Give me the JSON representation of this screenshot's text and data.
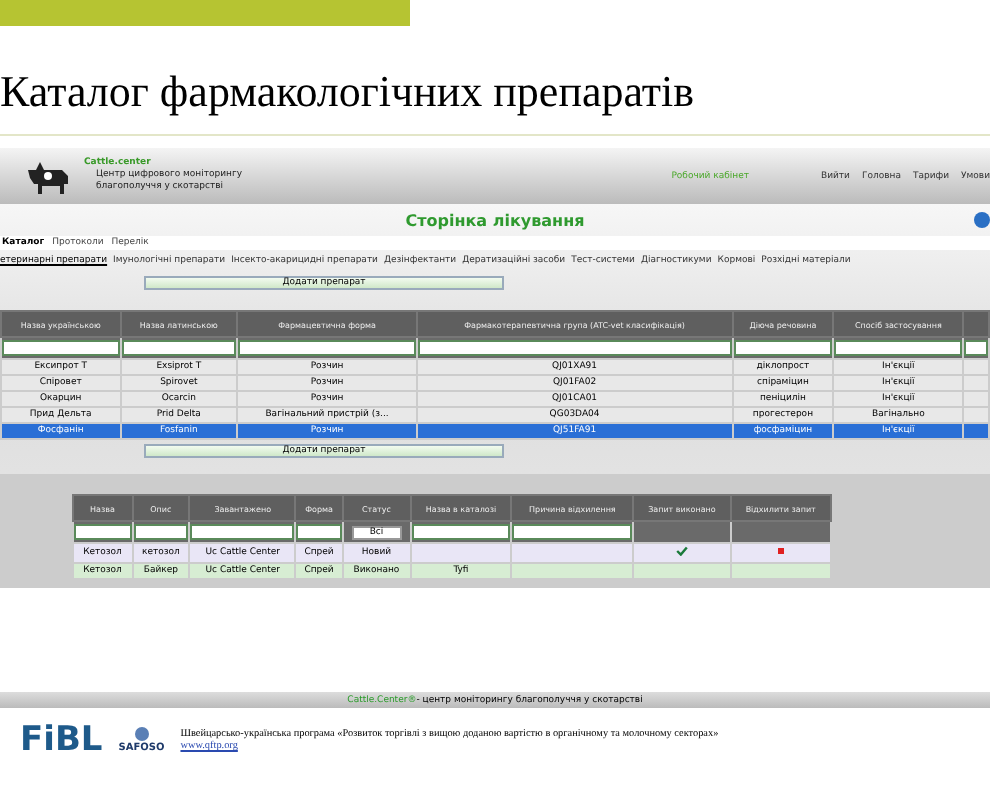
{
  "slide": {
    "title": "Каталог фармакологічних препаратів"
  },
  "header": {
    "brand": "Cattle.center",
    "tagline_1": "Центр цифрового моніторингу",
    "tagline_2": "благополуччя у скотарстві",
    "cabinet": "Робочий кабінет",
    "nav": [
      "Вийти",
      "Головна",
      "Тарифи",
      "Умови"
    ]
  },
  "page_title": "Сторінка лікування",
  "tabs": [
    {
      "label": "Каталог",
      "selected": true
    },
    {
      "label": "Протоколи",
      "selected": false
    },
    {
      "label": "Перелік",
      "selected": false
    }
  ],
  "subtabs": [
    {
      "label": "етеринарні препарати",
      "selected": true
    },
    {
      "label": "Імунологічні препарати",
      "selected": false
    },
    {
      "label": "Інсекто-акарицидні препарати",
      "selected": false
    },
    {
      "label": "Дезінфектанти",
      "selected": false
    },
    {
      "label": "Дератизаційні засоби",
      "selected": false
    },
    {
      "label": "Тест-системи",
      "selected": false
    },
    {
      "label": "Діагностикуми",
      "selected": false
    },
    {
      "label": "Кормові",
      "selected": false
    },
    {
      "label": "Розхідні матеріали",
      "selected": false
    }
  ],
  "add_button": "Додати препарат",
  "catalog": {
    "columns": [
      "Назва українською",
      "Назва латинською",
      "Фармацевтична форма",
      "Фармакотерапевтична група (ATC-vet класифікація)",
      "Діюча речовина",
      "Спосіб застосування"
    ],
    "rows": [
      {
        "cells": [
          "Ексипрот Т",
          "Exsiprot T",
          "Розчин",
          "QJ01XA91",
          "діклопрост",
          "Ін'єкції"
        ],
        "selected": false
      },
      {
        "cells": [
          "Спіровет",
          "Spirovet",
          "Розчин",
          "QJ01FA02",
          "спіраміцин",
          "Ін'єкції"
        ],
        "selected": false
      },
      {
        "cells": [
          "Окарцин",
          "Ocarcin",
          "Розчин",
          "QJ01CA01",
          "пеніцилін",
          "Ін'єкції"
        ],
        "selected": false
      },
      {
        "cells": [
          "Прид Дельта",
          "Prid Delta",
          "Вагінальний пристрій (з...",
          "QG03DA04",
          "прогестерон",
          "Вагінально"
        ],
        "selected": false
      },
      {
        "cells": [
          "Фосфанін",
          "Fosfanin",
          "Розчин",
          "QJ51FA91",
          "фосфаміцин",
          "Ін'єкції"
        ],
        "selected": true
      }
    ]
  },
  "add_button_2": "Додати препарат",
  "requests": {
    "columns": [
      "Назва",
      "Опис",
      "Завантажено",
      "Форма",
      "Статус",
      "Назва в каталозі",
      "Причина відхилення",
      "Запит виконано",
      "Відхилити запит"
    ],
    "status_filter": "Всі",
    "rows": [
      {
        "cells": [
          "Кетозол",
          "кетозол",
          "Uc Cattle Center",
          "Спрей",
          "Новий",
          "",
          ""
        ],
        "done": true,
        "rejectable": true,
        "kind": "new"
      },
      {
        "cells": [
          "Кетозол",
          "Байкер",
          "Uc Cattle Center",
          "Спрей",
          "Виконано",
          "Tyfi",
          ""
        ],
        "done": false,
        "rejectable": false,
        "kind": "done"
      }
    ]
  },
  "footer": {
    "brand": "Cattle.Center®",
    "text": " - центр моніторингу благополуччя у скотарстві"
  },
  "sponsors": {
    "logo_1": "FiBL",
    "logo_2": "SAFOSO",
    "program": "Швейцарсько-українська програма «Розвиток торгівлі з вищою доданою вартістю в органічному та молочному секторах»",
    "url": "www.qftp.org"
  }
}
